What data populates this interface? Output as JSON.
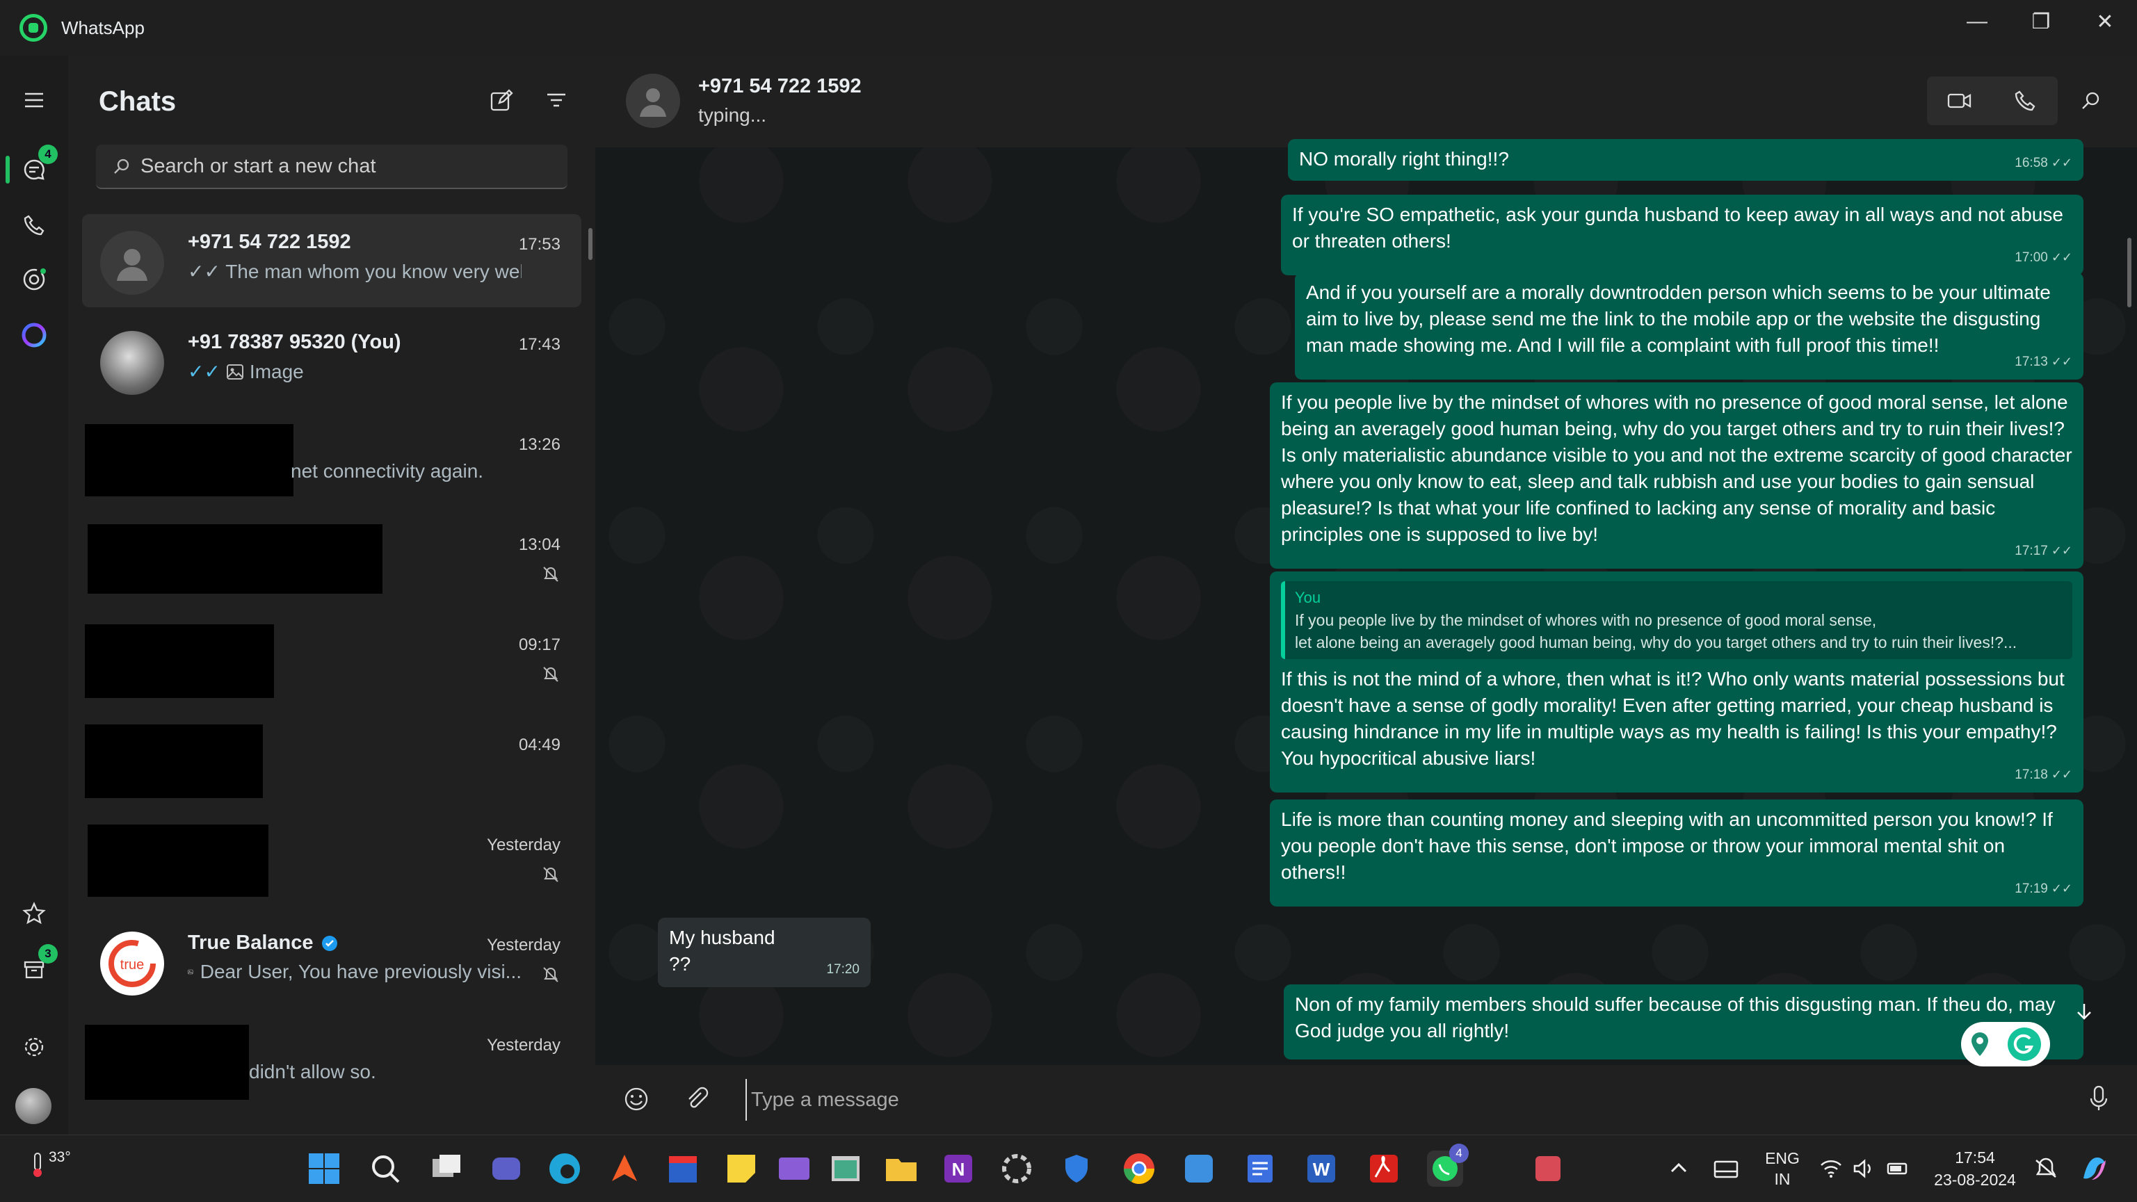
{
  "app": {
    "title": "WhatsApp"
  },
  "window": {
    "minimize": "—",
    "restore": "❐",
    "close": "✕"
  },
  "rail": {
    "chats_badge": "4",
    "archive_badge": "3"
  },
  "chatlist": {
    "heading": "Chats",
    "search_placeholder": "Search or start a new chat",
    "items": [
      {
        "name": "+971 54 722 1592",
        "preview": "✓✓ The man whom you know very well.",
        "time": "17:53"
      },
      {
        "name": "+91 78387 95320 (You)",
        "preview": "Image",
        "time": "17:43"
      },
      {
        "name": "",
        "preview": "net connectivity again.",
        "time": "13:26"
      },
      {
        "name": "",
        "preview": "",
        "time": "13:04"
      },
      {
        "name": "",
        "preview": "",
        "time": "09:17"
      },
      {
        "name": "",
        "preview": "",
        "time": "04:49"
      },
      {
        "name": "",
        "preview": "",
        "time": "Yesterday"
      },
      {
        "name": "True Balance",
        "preview": "Dear User,  You have previously visi...",
        "time": "Yesterday"
      },
      {
        "name": "",
        "preview": "didn't allow so.",
        "time": "Yesterday"
      }
    ]
  },
  "chat": {
    "contact": "+971 54 722 1592",
    "status": "typing...",
    "messages": [
      {
        "text": "NO morally right thing!!?",
        "time": "16:58"
      },
      {
        "text": "If you're SO empathetic, ask your gunda husband to keep away in all ways and not abuse or threaten others!",
        "time": "17:00"
      },
      {
        "text": "And if you yourself are a morally downtrodden person which seems to be your ultimate aim to live by, please send me the link to the mobile app or the website the disgusting man made showing me. And I will file a complaint with full proof this time!!",
        "time": "17:13"
      },
      {
        "text": "If you people live by the mindset of whores with no presence of good moral sense, let alone being an averagely good human being, why do you target others and try to ruin their lives!? Is only materialistic abundance visible to you and not the extreme scarcity of good character where you only know to eat, sleep and talk rubbish and use your bodies to gain sensual pleasure!? Is that what your life confined to lacking any sense of morality and basic principles one is supposed to live by!",
        "time": "17:17"
      },
      {
        "quote_name": "You",
        "quote_line1": "If you people live by the mindset of whores with no presence of good moral sense,",
        "quote_line2": "let alone being an averagely good human being, why do you target others and try to ruin their lives!?...",
        "text": "If this is not the mind of a whore, then what is it!? Who only wants material possessions but doesn't have a sense of godly morality! Even after getting married, your cheap husband is causing hindrance in my life in multiple ways as my health is failing! Is this your empathy!? You hypocritical abusive liars!",
        "time": "17:18"
      },
      {
        "text": "Life is more than counting money and sleeping with an uncommitted person you know!? If you people don't have this sense, don't impose or throw your immoral mental shit on others!!",
        "time": "17:19"
      },
      {
        "text": "My husband ??",
        "time": "17:20"
      },
      {
        "text": "Non of my family members should suffer because of this disgusting man. If theu do, may God judge you all rightly!",
        "time": ""
      }
    ],
    "composer_placeholder": "Type a message"
  },
  "taskbar": {
    "weather": "33°",
    "lang1": "ENG",
    "lang2": "IN",
    "time": "17:54",
    "date": "23-08-2024",
    "whatsapp_badge": "4"
  },
  "colors": {
    "accent": "#21c063",
    "bubble_out": "#005c4b",
    "bubble_in": "#2a2f32"
  }
}
